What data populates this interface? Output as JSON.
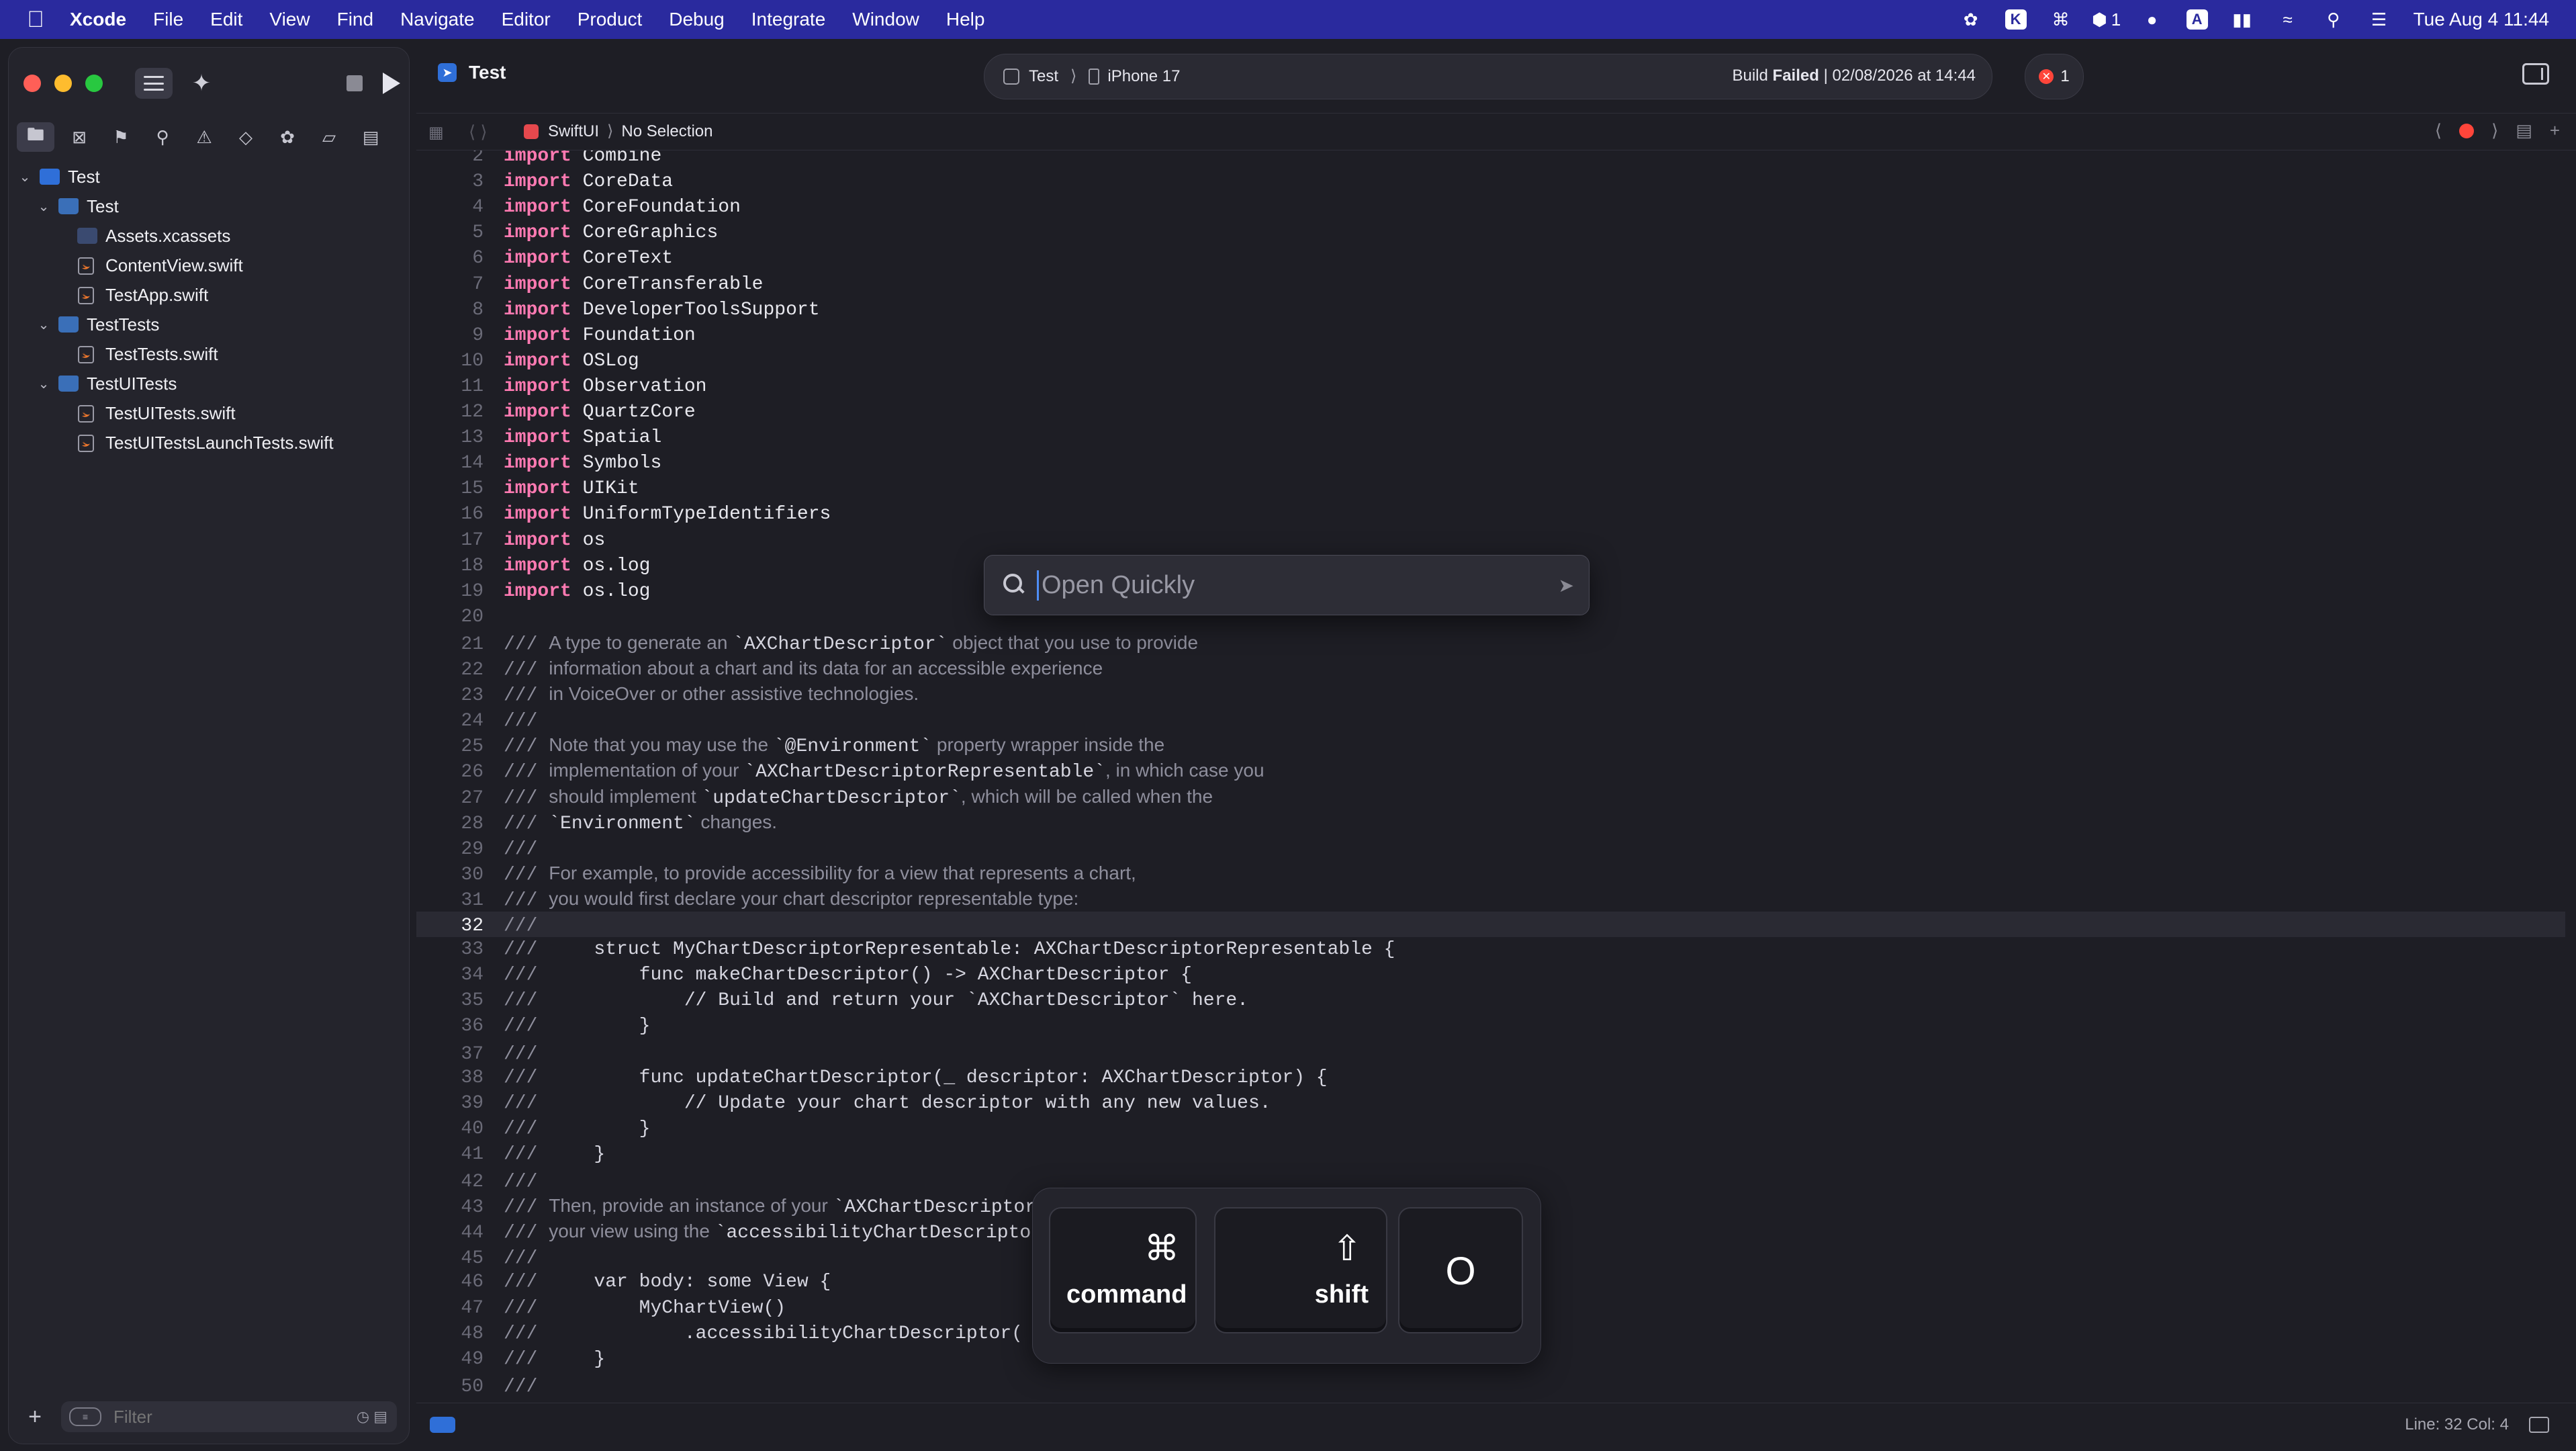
{
  "menubar": {
    "app": "Xcode",
    "items": [
      "File",
      "Edit",
      "View",
      "Find",
      "Navigate",
      "Editor",
      "Product",
      "Debug",
      "Integrate",
      "Window",
      "Help"
    ],
    "status_badge_count": "1",
    "clock": "Tue Aug 4  11:44"
  },
  "toolbar": {
    "doc_title": "Test",
    "scheme": "Test",
    "device": "iPhone 17",
    "build_prefix": "Build",
    "build_state": "Failed",
    "build_time": "| 02/08/2026 at 14:44",
    "error_count": "1"
  },
  "jumpbar": {
    "crumb1": "SwiftUI",
    "crumb2": "No Selection"
  },
  "sidebar": {
    "tree": [
      {
        "label": "Test",
        "level": 0,
        "kind": "proj",
        "chev": "⌄"
      },
      {
        "label": "Test",
        "level": 1,
        "kind": "folder",
        "chev": "⌄"
      },
      {
        "label": "Assets.xcassets",
        "level": 2,
        "kind": "assets",
        "chev": ""
      },
      {
        "label": "ContentView.swift",
        "level": 2,
        "kind": "swift",
        "chev": ""
      },
      {
        "label": "TestApp.swift",
        "level": 2,
        "kind": "swift",
        "chev": ""
      },
      {
        "label": "TestTests",
        "level": 1,
        "kind": "folder",
        "chev": "⌄"
      },
      {
        "label": "TestTests.swift",
        "level": 2,
        "kind": "swift",
        "chev": ""
      },
      {
        "label": "TestUITests",
        "level": 1,
        "kind": "folder",
        "chev": "⌄"
      },
      {
        "label": "TestUITests.swift",
        "level": 2,
        "kind": "swift",
        "chev": ""
      },
      {
        "label": "TestUITestsLaunchTests.swift",
        "level": 2,
        "kind": "swift",
        "chev": ""
      }
    ],
    "filter_placeholder": "Filter"
  },
  "editor": {
    "current_line": 32,
    "lines": [
      {
        "n": 2,
        "t": "import",
        "s": "Combine"
      },
      {
        "n": 3,
        "t": "import",
        "s": "CoreData"
      },
      {
        "n": 4,
        "t": "import",
        "s": "CoreFoundation"
      },
      {
        "n": 5,
        "t": "import",
        "s": "CoreGraphics"
      },
      {
        "n": 6,
        "t": "import",
        "s": "CoreText"
      },
      {
        "n": 7,
        "t": "import",
        "s": "CoreTransferable"
      },
      {
        "n": 8,
        "t": "import",
        "s": "DeveloperToolsSupport"
      },
      {
        "n": 9,
        "t": "import",
        "s": "Foundation"
      },
      {
        "n": 10,
        "t": "import",
        "s": "OSLog"
      },
      {
        "n": 11,
        "t": "import",
        "s": "Observation"
      },
      {
        "n": 12,
        "t": "import",
        "s": "QuartzCore"
      },
      {
        "n": 13,
        "t": "import",
        "s": "Spatial"
      },
      {
        "n": 14,
        "t": "import",
        "s": "Symbols"
      },
      {
        "n": 15,
        "t": "import",
        "s": "UIKit"
      },
      {
        "n": 16,
        "t": "import",
        "s": "UniformTypeIdentifiers"
      },
      {
        "n": 17,
        "t": "import",
        "s": "os"
      },
      {
        "n": 18,
        "t": "import",
        "s": "os.log"
      },
      {
        "n": 19,
        "t": "import",
        "s": "os.log"
      },
      {
        "n": 20,
        "t": "blank",
        "s": ""
      },
      {
        "n": 21,
        "t": "doc",
        "s": "A type to generate an `AXChartDescriptor` object that you use to provide"
      },
      {
        "n": 22,
        "t": "doc",
        "s": "information about a chart and its data for an accessible experience"
      },
      {
        "n": 23,
        "t": "doc",
        "s": "in VoiceOver or other assistive technologies."
      },
      {
        "n": 24,
        "t": "doc",
        "s": ""
      },
      {
        "n": 25,
        "t": "doc",
        "s": "Note that you may use the `@Environment` property wrapper inside the"
      },
      {
        "n": 26,
        "t": "doc",
        "s": "implementation of your `AXChartDescriptorRepresentable`, in which case you"
      },
      {
        "n": 27,
        "t": "doc",
        "s": "should implement `updateChartDescriptor`, which will be called when the"
      },
      {
        "n": 28,
        "t": "doc",
        "s": "`Environment` changes."
      },
      {
        "n": 29,
        "t": "doc",
        "s": ""
      },
      {
        "n": 30,
        "t": "doc",
        "s": "For example, to provide accessibility for a view that represents a chart,"
      },
      {
        "n": 31,
        "t": "doc",
        "s": "you would first declare your chart descriptor representable type:"
      },
      {
        "n": 32,
        "t": "doc",
        "s": ""
      },
      {
        "n": 33,
        "t": "doccode",
        "s": "    struct MyChartDescriptorRepresentable: AXChartDescriptorRepresentable {"
      },
      {
        "n": 34,
        "t": "doccode",
        "s": "        func makeChartDescriptor() -> AXChartDescriptor {"
      },
      {
        "n": 35,
        "t": "doccode",
        "s": "            // Build and return your `AXChartDescriptor` here."
      },
      {
        "n": 36,
        "t": "doccode",
        "s": "        }"
      },
      {
        "n": 37,
        "t": "doc",
        "s": ""
      },
      {
        "n": 38,
        "t": "doccode",
        "s": "        func updateChartDescriptor(_ descriptor: AXChartDescriptor) {"
      },
      {
        "n": 39,
        "t": "doccode",
        "s": "            // Update your chart descriptor with any new values."
      },
      {
        "n": 40,
        "t": "doccode",
        "s": "        }"
      },
      {
        "n": 41,
        "t": "doccode",
        "s": "    }"
      },
      {
        "n": 42,
        "t": "doc",
        "s": ""
      },
      {
        "n": 43,
        "t": "doc",
        "s": "Then, provide an instance of your `AXChartDescriptorRepresentable`"
      },
      {
        "n": 44,
        "t": "doc",
        "s": "your view using the `accessibilityChartDescriptor`"
      },
      {
        "n": 45,
        "t": "doc",
        "s": ""
      },
      {
        "n": 46,
        "t": "doccode",
        "s": "    var body: some View {"
      },
      {
        "n": 47,
        "t": "doccode",
        "s": "        MyChartView()"
      },
      {
        "n": 48,
        "t": "doccode",
        "s": "            .accessibilityChartDescriptor("
      },
      {
        "n": 49,
        "t": "doccode",
        "s": "    }"
      },
      {
        "n": 50,
        "t": "doc",
        "s": ""
      }
    ]
  },
  "statusbar": {
    "position": "Line: 32  Col: 4"
  },
  "open_quickly": {
    "placeholder": "Open Quickly"
  },
  "keycast": {
    "command_label": "command",
    "command_symbol": "⌘",
    "shift_label": "shift",
    "shift_symbol": "⇧",
    "key": "O"
  }
}
